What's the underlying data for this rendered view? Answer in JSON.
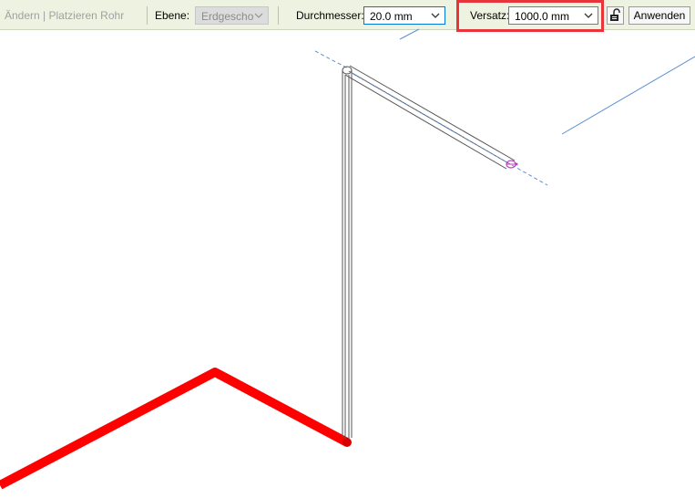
{
  "options_bar": {
    "context_title": "Ändern | Platzieren Rohr",
    "level_label": "Ebene:",
    "level_value": "Erdgeschos",
    "diameter_label": "Durchmesser:",
    "diameter_value": "20.0 mm",
    "offset_label": "Versatz:",
    "offset_value": "1000.0 mm",
    "apply_button": "Anwenden"
  },
  "colors": {
    "options_bar_bg": "#eef3e1",
    "highlight": "#e8353b",
    "existing_pipe": "#ff0000",
    "new_pipe": "#555555",
    "reference_lines": "#5b8fd6",
    "connector": "#c040c0"
  },
  "icons": [
    "chevron-down-icon",
    "lock-icon"
  ]
}
